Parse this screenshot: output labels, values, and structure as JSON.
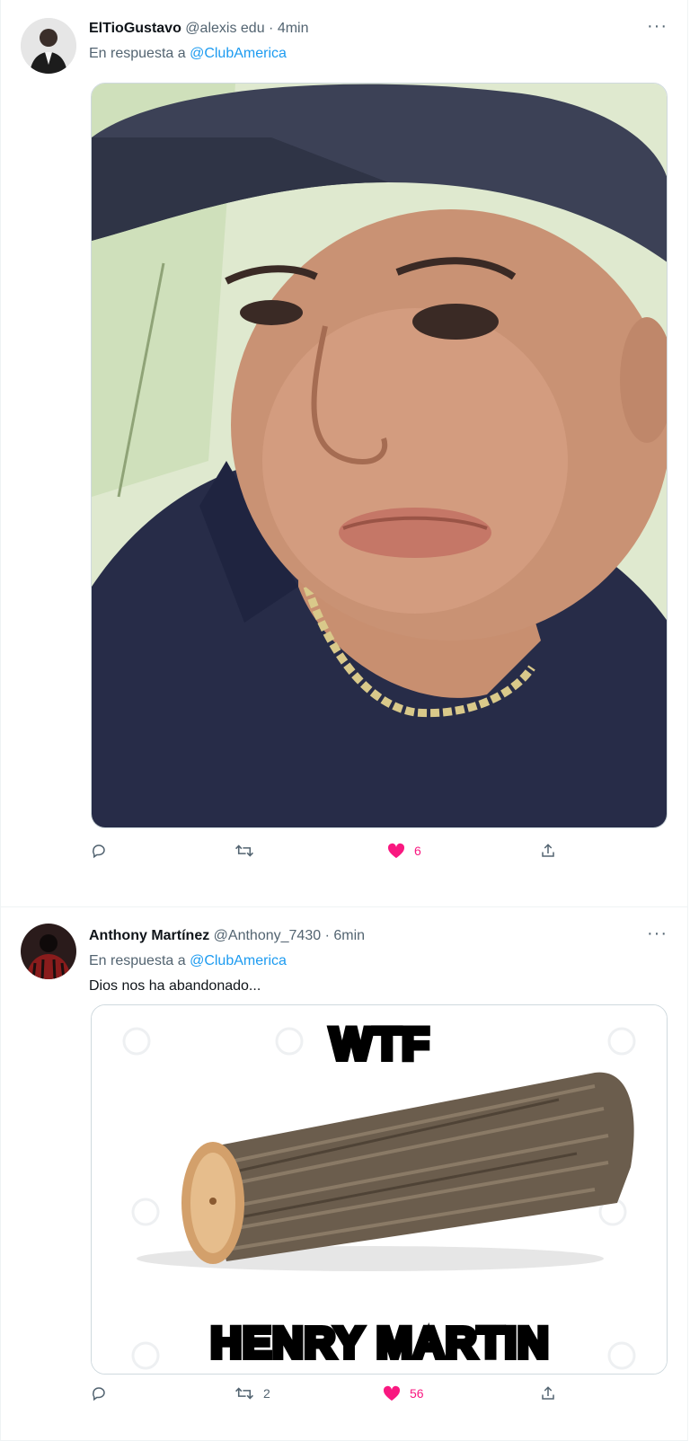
{
  "tweets": [
    {
      "display_name": "ElTioGustavo",
      "handle": "@alexis edu",
      "time": "· 4min",
      "reply_prefix": "En respuesta a",
      "reply_mention": "@ClubAmerica",
      "more": "···",
      "actions": {
        "reply_count": "",
        "retweet_count": "",
        "like_count": "6"
      }
    },
    {
      "display_name": "Anthony Martínez",
      "handle": "@Anthony_7430",
      "time": "· 6min",
      "reply_prefix": "En respuesta a",
      "reply_mention": "@ClubAmerica",
      "text": "Dios nos ha abandonado...",
      "more": "···",
      "meme": {
        "top": "WTF",
        "bottom": "HENRY MARTIN"
      },
      "actions": {
        "reply_count": "",
        "retweet_count": "2",
        "like_count": "56"
      }
    }
  ],
  "colors": {
    "like": "#f91880",
    "mention": "#1d9bf0",
    "muted": "#536471"
  },
  "icons": {
    "reply": "reply-icon",
    "retweet": "retweet-icon",
    "like": "heart-icon",
    "share": "share-icon",
    "more": "more-icon"
  }
}
